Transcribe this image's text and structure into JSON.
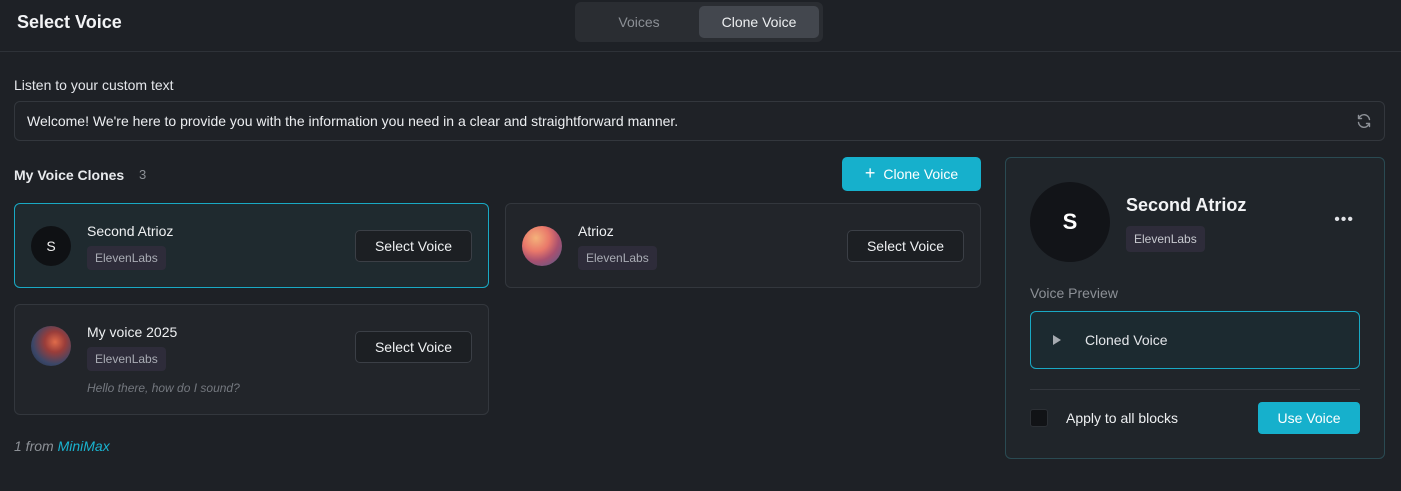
{
  "header": {
    "title": "Select Voice",
    "tabs": [
      {
        "label": "Voices",
        "active": false
      },
      {
        "label": "Clone Voice",
        "active": true
      }
    ]
  },
  "custom_text": {
    "label": "Listen to your custom text",
    "value": "Welcome! We're here to provide you with the information you need in a clear and straightforward manner."
  },
  "clones": {
    "label": "My Voice Clones",
    "count": "3",
    "clone_button": "Clone Voice",
    "items": [
      {
        "name": "Second Atrioz",
        "initial": "S",
        "provider": "ElevenLabs",
        "button": "Select Voice",
        "selected": true,
        "avatar": "initial"
      },
      {
        "name": "Atrioz",
        "provider": "ElevenLabs",
        "button": "Select Voice",
        "selected": false,
        "avatar": "sunset-photo"
      },
      {
        "name": "My voice 2025",
        "provider": "ElevenLabs",
        "button": "Select Voice",
        "selected": false,
        "avatar": "person-photo",
        "sample": "Hello there, how do I sound?"
      }
    ],
    "from_prefix": "1 from",
    "from_link": "MiniMax"
  },
  "panel": {
    "initial": "S",
    "name": "Second Atrioz",
    "provider": "ElevenLabs",
    "more_icon": "ellipsis-icon",
    "preview_label": "Voice Preview",
    "preview_text": "Cloned Voice",
    "apply_label": "Apply to all blocks",
    "use_button": "Use Voice"
  },
  "colors": {
    "accent": "#16b0cc",
    "background": "#1e2126",
    "badge": "#2e2c3a"
  }
}
